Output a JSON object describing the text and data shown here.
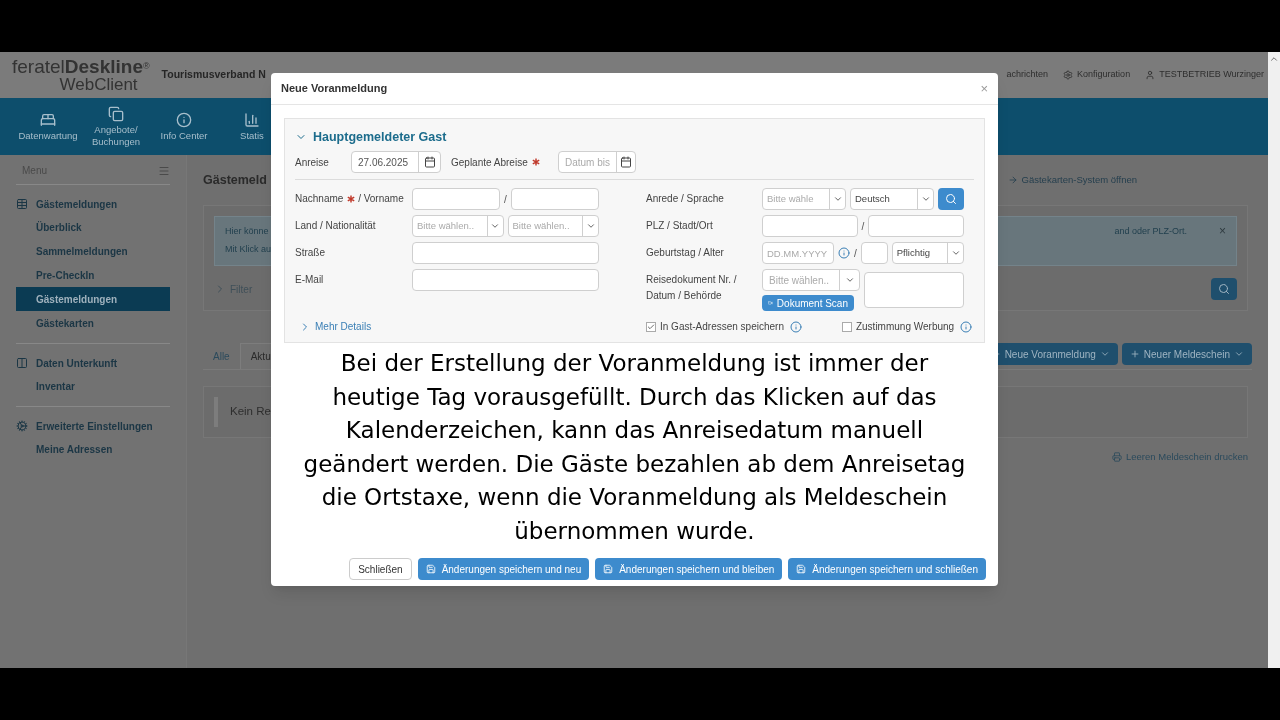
{
  "header": {
    "logo_light": "feratel",
    "logo_bold": "Deskline",
    "logo_mark": "®",
    "logo_sub": "WebClient",
    "org": "Tourismusverband N",
    "links": [
      {
        "label": "achrichten"
      },
      {
        "label": "Konfiguration"
      },
      {
        "label": "TESTBETRIEB Wurzinger"
      }
    ]
  },
  "nav": [
    {
      "label": "Datenwartung"
    },
    {
      "label": "Angebote/ Buchungen"
    },
    {
      "label": "Info Center"
    },
    {
      "label": "Statis"
    }
  ],
  "sidebar": {
    "title": "Menu",
    "groups": [
      {
        "title": "Gästemeldungen",
        "items": [
          {
            "label": "Überblick",
            "selected": false
          },
          {
            "label": "Sammelmeldungen",
            "selected": false
          },
          {
            "label": "Pre-CheckIn",
            "selected": false
          },
          {
            "label": "Gästemeldungen",
            "selected": true
          },
          {
            "label": "Gästekarten",
            "selected": false
          }
        ]
      },
      {
        "title": "Daten Unterkunft",
        "items": [
          {
            "label": "Inventar",
            "selected": false
          }
        ]
      },
      {
        "title": "Erweiterte Einstellungen",
        "items": [
          {
            "label": "Meine Adressen",
            "selected": false
          }
        ]
      }
    ]
  },
  "main": {
    "title": "Gästemeld",
    "link": "Gästekarten-System öffnen",
    "info_lines": [
      "Hier könne",
      "Mit Klick au"
    ],
    "info_right": "and oder PLZ-Ort.",
    "info_close": "×",
    "filter": "Filter",
    "tabs": [
      {
        "label": "Alle",
        "selected": false
      },
      {
        "label": "Aktu",
        "selected": true
      }
    ],
    "actions": [
      {
        "label": "Neue Voranmeldung"
      },
      {
        "label": "Neuer Meldeschein"
      }
    ],
    "empty": "Kein Re",
    "print": "Leeren Meldeschein drucken"
  },
  "modal": {
    "title": "Neue Voranmeldung",
    "close": "×",
    "section": {
      "title": "Hauptgemeldeter Gast",
      "expanded": true
    },
    "arrival": {
      "label": "Anreise",
      "value": "27.06.2025"
    },
    "departure": {
      "label": "Geplante Abreise",
      "required": true,
      "placeholder": "Datum bis"
    },
    "left_rows": [
      {
        "label": "Nachname",
        "required": true,
        "label_rest": " / Vorname",
        "fields": [
          {
            "kind": "input"
          },
          {
            "kind": "slash",
            "text": "/"
          },
          {
            "kind": "input"
          }
        ]
      },
      {
        "label": "Land / Nationalität",
        "required": false,
        "fields": [
          {
            "kind": "select",
            "placeholder": "Bitte wählen.."
          },
          {
            "kind": "select",
            "placeholder": "Bitte wählen.."
          }
        ]
      },
      {
        "label": "Straße",
        "required": false,
        "fields": [
          {
            "kind": "input"
          }
        ]
      },
      {
        "label": "E-Mail",
        "required": false,
        "fields": [
          {
            "kind": "input"
          }
        ]
      }
    ],
    "right_rows": [
      {
        "label": "Anrede / Sprache",
        "required": false,
        "fields": [
          {
            "kind": "select",
            "placeholder": "Bitte wähle"
          },
          {
            "kind": "select",
            "value": "Deutsch"
          },
          {
            "kind": "search"
          }
        ]
      },
      {
        "label": "PLZ / Stadt/Ort",
        "required": false,
        "fields": [
          {
            "kind": "input"
          },
          {
            "kind": "slash",
            "text": "/"
          },
          {
            "kind": "input"
          }
        ]
      },
      {
        "label": "Geburtstag / Alter",
        "required": false,
        "fields": [
          {
            "kind": "input",
            "placeholder": "DD.MM.YYYY"
          },
          {
            "kind": "info"
          },
          {
            "kind": "slash",
            "text": "/"
          },
          {
            "kind": "narrow"
          },
          {
            "kind": "select",
            "value": "Pflichtig"
          }
        ]
      },
      {
        "label": "Reisedokument Nr. / Datum / Behörde",
        "required": false,
        "fields": [
          {
            "kind": "document",
            "placeholder": "Bitte wählen..",
            "action": "Dokument Scan"
          },
          {
            "kind": "textarea"
          }
        ]
      }
    ],
    "more": "Mehr Details",
    "checkboxes": [
      {
        "label": "In Gast-Adressen speichern",
        "checked": true
      },
      {
        "label": "Zustimmung Werbung",
        "checked": false
      }
    ],
    "caption": [
      "Bei der Erstellung der Voranmeldung ist immer der",
      "heutige Tag vorausgefüllt. Durch das Klicken auf das",
      "Kalenderzeichen, kann das Anreisedatum manuell",
      "geändert werden. Die Gäste bezahlen ab dem Anreisetag",
      "die Ortstaxe, wenn die Voranmeldung als Meldeschein",
      "übernommen wurde."
    ],
    "buttons": [
      {
        "label": "Schließen",
        "kind": "default"
      },
      {
        "label": "Änderungen speichern und neu",
        "kind": "primary"
      },
      {
        "label": "Änderungen speichern und bleiben",
        "kind": "primary"
      },
      {
        "label": "Änderungen speichern und schließen",
        "kind": "primary"
      }
    ]
  }
}
